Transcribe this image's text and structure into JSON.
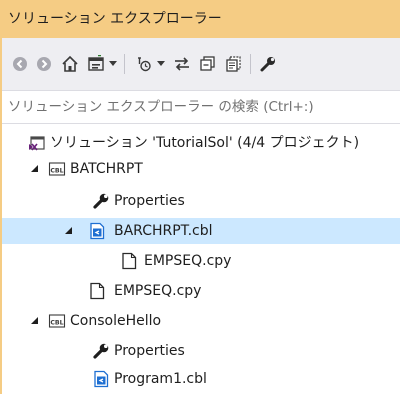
{
  "window": {
    "title": "ソリューション エクスプローラー"
  },
  "toolbar": {
    "buttons": [
      {
        "name": "back-icon"
      },
      {
        "name": "forward-icon"
      },
      {
        "name": "home-icon"
      },
      {
        "name": "switch-views-icon"
      },
      {
        "name": "pending-changes-icon"
      },
      {
        "name": "sync-with-active-document-icon"
      },
      {
        "name": "collapse-all-icon"
      },
      {
        "name": "show-all-files-icon"
      },
      {
        "name": "properties-wrench-icon"
      }
    ]
  },
  "search": {
    "placeholder": "ソリューション エクスプローラー の検索 (Ctrl+:)"
  },
  "tree": {
    "items": [
      {
        "label": "ソリューション 'TutorialSol' (4/4 プロジェクト)",
        "type": "solution"
      },
      {
        "label": "BATCHRPT",
        "type": "cobol-project",
        "expanded": true
      },
      {
        "label": "Properties",
        "type": "properties"
      },
      {
        "label": "BARCHRPT.cbl",
        "type": "cobol-file",
        "expanded": true,
        "selected": true
      },
      {
        "label": "EMPSEQ.cpy",
        "type": "copybook"
      },
      {
        "label": "EMPSEQ.cpy",
        "type": "copybook"
      },
      {
        "label": "ConsoleHello",
        "type": "cobol-project",
        "expanded": true
      },
      {
        "label": "Properties",
        "type": "properties"
      },
      {
        "label": "Program1.cbl",
        "type": "cobol-file"
      }
    ]
  },
  "colors": {
    "title_bar": "#f5cc84",
    "toolbar_bg": "#eeeef2",
    "selection": "#cce8ff",
    "file_icon_blue": "#1e6fd2"
  }
}
